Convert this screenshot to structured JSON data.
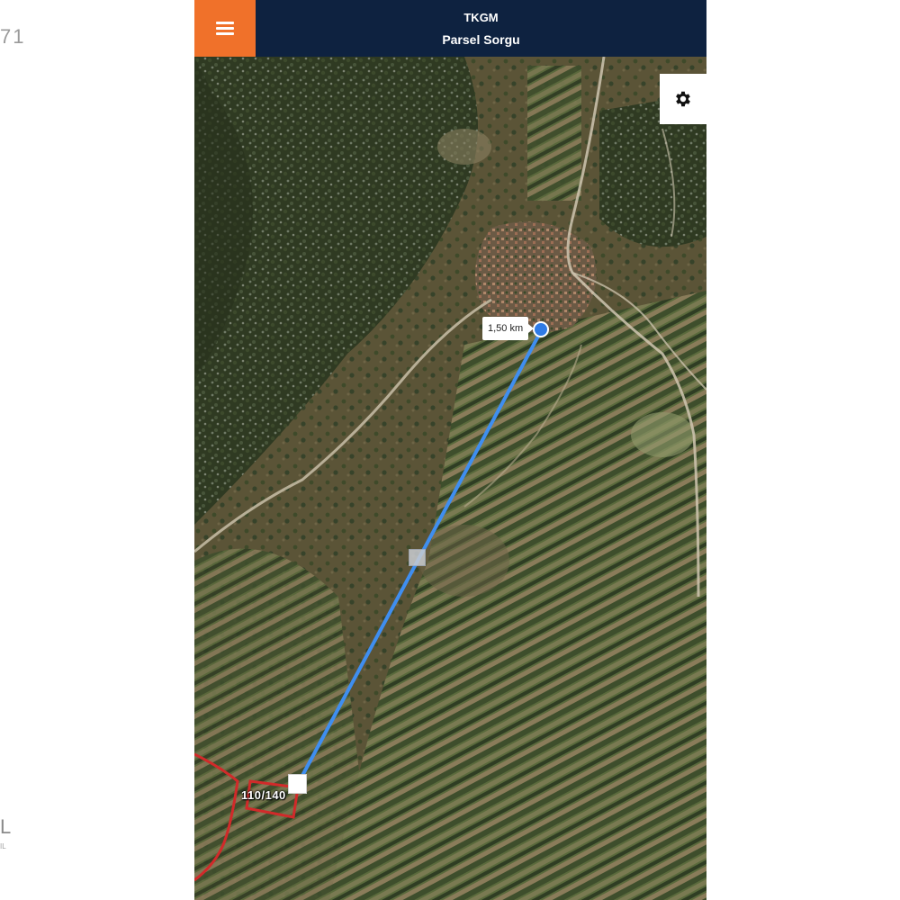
{
  "background": {
    "number_text": "71",
    "letter_text": "L",
    "small_text": "IL"
  },
  "header": {
    "app_name": "TKGM",
    "subtitle": "Parsel Sorgu",
    "menu_icon": "hamburger-menu-icon",
    "bar_color": "#0e2240",
    "accent_color": "#f0712a"
  },
  "map": {
    "settings_icon": "gear-icon",
    "measurement": {
      "distance_label": "1,50 km",
      "line_color": "#3f8ef0"
    },
    "parcel": {
      "label": "110/140",
      "outline_color": "#d12a2a"
    },
    "imagery": "satellite"
  }
}
